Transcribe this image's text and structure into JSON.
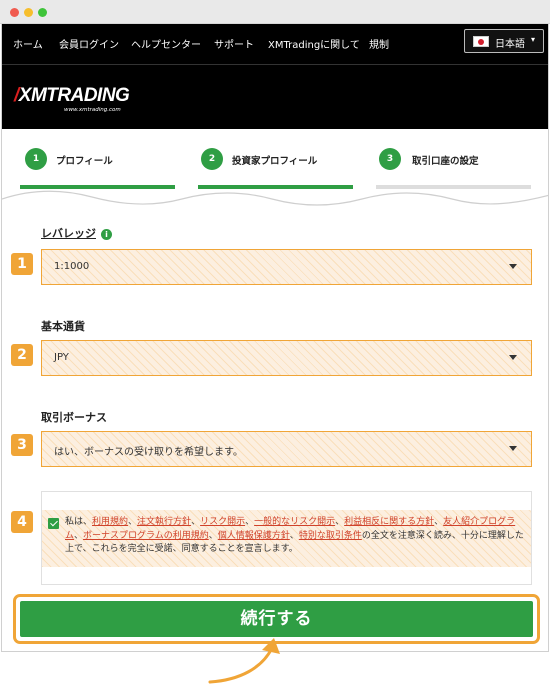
{
  "nav": {
    "items": [
      "ホーム",
      "会員ログイン",
      "ヘルプセンター",
      "サポート",
      "XMTradingに関して",
      "規制"
    ],
    "language": "日本語"
  },
  "brand": {
    "logo": "XMTRADING",
    "logo_mark": "/",
    "url": "www.xmtrading.com"
  },
  "steps": [
    {
      "number": "1",
      "label": "プロフィール"
    },
    {
      "number": "2",
      "label": "投資家プロフィール"
    },
    {
      "number": "3",
      "label": "取引口座の設定"
    }
  ],
  "form": {
    "leverage": {
      "badge": "1",
      "label": "レバレッジ",
      "value": "1:1000",
      "info_icon": "i"
    },
    "currency": {
      "badge": "2",
      "label": "基本通貨",
      "value": "JPY"
    },
    "bonus": {
      "badge": "3",
      "label": "取引ボーナス",
      "value": "はい、ボーナスの受け取りを希望します。"
    },
    "terms": {
      "badge": "4",
      "checked": true,
      "prefix": "私は、",
      "links": [
        "利用規約",
        "注文執行方針",
        "リスク開示",
        "一般的なリスク開示",
        "利益相反に関する方針",
        "友人紹介プログラム",
        "ボーナスプログラムの利用規約",
        "個人情報保護方針",
        "特別な取引条件"
      ],
      "separator": "、",
      "suffix": "の全文を注意深く読み、十分に理解した上で、これらを完全に受諾、同意することを宣言します。"
    }
  },
  "cta": {
    "label": "続行する"
  },
  "colors": {
    "accent_green": "#2f9e44",
    "highlight_orange": "#f0a537",
    "link_red": "#d0422a",
    "nav_black": "#000000"
  },
  "icons": {
    "checkbox": "checkbox-checked-icon",
    "dropdown": "chevron-down-icon",
    "info": "info-icon",
    "flag": "japan-flag-icon",
    "arrow": "curved-arrow-icon"
  }
}
